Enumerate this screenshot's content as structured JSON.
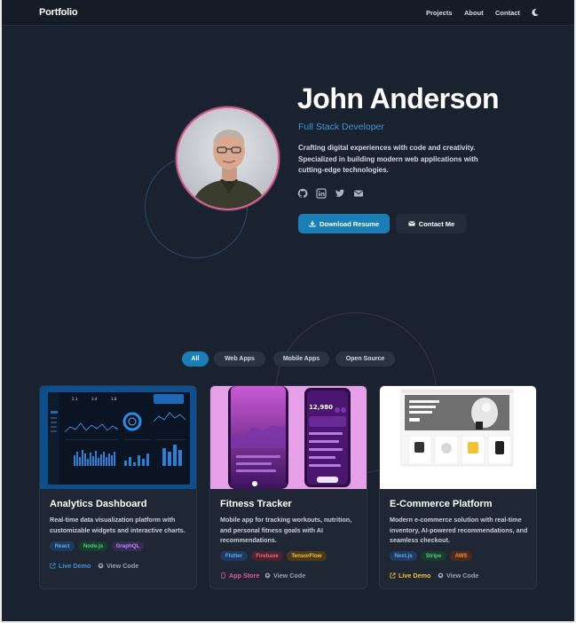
{
  "nav": {
    "brand": "Portfolio",
    "links": [
      "Projects",
      "About",
      "Contact"
    ],
    "theme_icon": "moon-icon"
  },
  "hero": {
    "name": "John Anderson",
    "role": "Full Stack Developer",
    "description": "Crafting digital experiences with code and creativity. Specialized in building modern web applications with cutting-edge technologies.",
    "social_icons": [
      "github-icon",
      "linkedin-icon",
      "twitter-icon",
      "mail-icon"
    ],
    "primary_button": "Download Resume",
    "secondary_button": "Contact Me"
  },
  "filters": {
    "options": [
      "All",
      "Web Apps",
      "Mobile Apps",
      "Open Source"
    ],
    "active": "All"
  },
  "projects": [
    {
      "title": "Analytics Dashboard",
      "description": "Real-time data visualization platform with customizable widgets and interactive charts.",
      "tags": [
        "React",
        "Node.js",
        "GraphQL"
      ],
      "primary_link": "Live Demo",
      "secondary_link": "View Code"
    },
    {
      "title": "Fitness Tracker",
      "description": "Mobile app for tracking workouts, nutrition, and personal fitness goals with AI recommendations.",
      "tags": [
        "Flutter",
        "Firebase",
        "TensorFlow"
      ],
      "primary_link": "App Store",
      "secondary_link": "View Code",
      "phone_stat": "12,980"
    },
    {
      "title": "E-Commerce Platform",
      "description": "Modern e-commerce solution with real-time inventory, AI-powered recommendations, and seamless checkout.",
      "tags": [
        "Next.js",
        "Stripe",
        "AWS"
      ],
      "primary_link": "Live Demo",
      "secondary_link": "View Code"
    }
  ],
  "colors": {
    "background": "#1a2230",
    "accent": "#1a7fb6",
    "role_text": "#3b97d6",
    "pink": "#e45a94",
    "yellow": "#f2c230"
  }
}
